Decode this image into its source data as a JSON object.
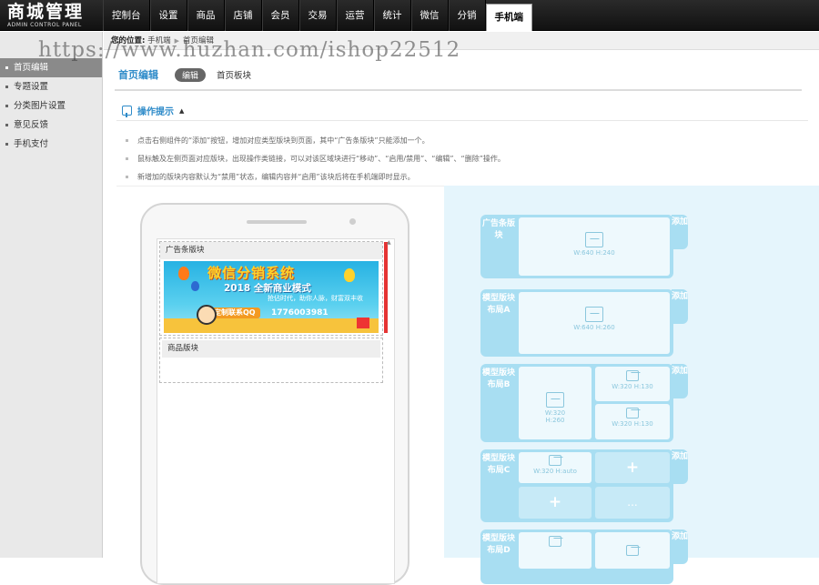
{
  "brand": {
    "title": "商城管理",
    "subtitle": "ADMIN CONTROL PANEL"
  },
  "nav": [
    "控制台",
    "设置",
    "商品",
    "店铺",
    "会员",
    "交易",
    "运营",
    "统计",
    "微信",
    "分销",
    "手机端"
  ],
  "nav_active": "手机端",
  "sidebar": {
    "items": [
      "首页编辑",
      "专题设置",
      "分类图片设置",
      "意见反馈",
      "手机支付"
    ],
    "active": "首页编辑"
  },
  "breadcrumb": {
    "label": "您的位置:",
    "path": [
      "手机端",
      "首页编辑"
    ]
  },
  "watermark": "https://www.huzhan.com/ishop22512",
  "tabs": {
    "title": "首页编辑",
    "active_pill": "编辑",
    "other": "首页板块"
  },
  "tips": {
    "header": "操作提示",
    "lines": [
      "点击右侧组件的“添加”按钮，增加对应类型版块到页面，其中“广告条版块”只能添加一个。",
      "鼠标触及左侧页面对应版块，出现操作类链接，可以对该区域块进行“移动”、“启用/禁用”、“编辑”、“删除”操作。",
      "新增加的版块内容默认为“禁用”状态，编辑内容并“启用”该块后将在手机端即时显示。"
    ]
  },
  "phone": {
    "blocks": [
      {
        "title": "广告条版块"
      },
      {
        "title": "商品版块"
      }
    ],
    "banner": {
      "headline": "微信分销系统",
      "subheadline": "2018 全新商业模式",
      "slogan": "抢佔时代，助你人脉，财富双丰收",
      "qq_label": "定制联系QQ",
      "qq_number": "1776003981"
    }
  },
  "modules": [
    {
      "label": "广告条版块",
      "add": "添加",
      "slots": [
        "W:640  H:240"
      ]
    },
    {
      "label": "模型版块布局A",
      "add": "添加",
      "slots": [
        "W:640  H:260"
      ]
    },
    {
      "label": "模型版块布局B",
      "add": "添加",
      "slots": [
        "W:320\nH:260",
        "W:320  H:130",
        "W:320  H:130"
      ]
    },
    {
      "label": "模型版块布局C",
      "add": "添加",
      "slots": [
        "W:320  H:auto",
        "+",
        "+",
        "..."
      ]
    },
    {
      "label": "模型版块布局D",
      "add": "添加",
      "slots": [
        "",
        ""
      ]
    }
  ],
  "colors": {
    "topbar": "#1a1a1a",
    "accent": "#2e8bc9",
    "module_bg": "#e5f5fc",
    "module_card": "#a8def2"
  }
}
